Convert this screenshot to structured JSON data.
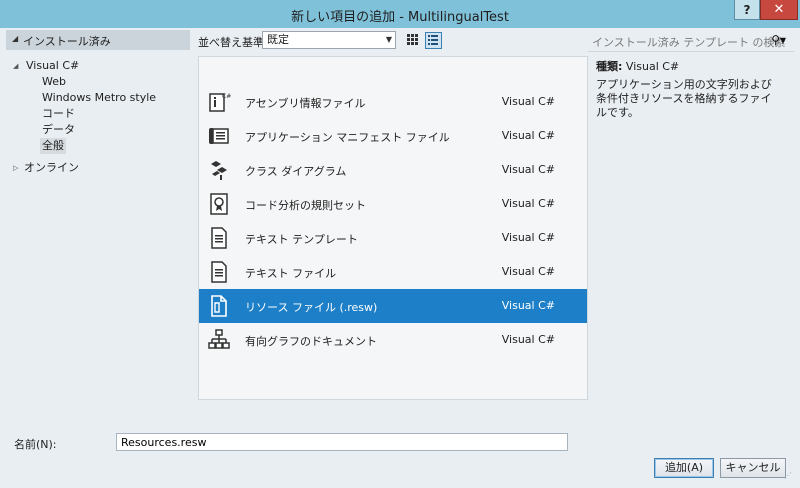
{
  "window": {
    "title": "新しい項目の追加 - MultilingualTest",
    "help_label": "?",
    "close_label": "✕"
  },
  "left_panel": {
    "header": "インストール済み",
    "tree": {
      "visual_csharp": "Visual C#",
      "children": [
        "Web",
        "Windows Metro style",
        "コード",
        "データ",
        "全般"
      ],
      "online": "オンライン"
    }
  },
  "toolbar": {
    "sort_label": "並べ替え基準:",
    "sort_value": "既定"
  },
  "templates": [
    {
      "name": "アセンブリ情報ファイル",
      "lang": "Visual C#",
      "icon": "assembly-info-icon"
    },
    {
      "name": "アプリケーション マニフェスト ファイル",
      "lang": "Visual C#",
      "icon": "manifest-icon"
    },
    {
      "name": "クラス ダイアグラム",
      "lang": "Visual C#",
      "icon": "class-diagram-icon"
    },
    {
      "name": "コード分析の規則セット",
      "lang": "Visual C#",
      "icon": "ruleset-icon"
    },
    {
      "name": "テキスト テンプレート",
      "lang": "Visual C#",
      "icon": "text-template-icon"
    },
    {
      "name": "テキスト ファイル",
      "lang": "Visual C#",
      "icon": "text-file-icon"
    },
    {
      "name": "リソース ファイル (.resw)",
      "lang": "Visual C#",
      "icon": "resource-file-icon",
      "selected": true
    },
    {
      "name": "有向グラフのドキュメント",
      "lang": "Visual C#",
      "icon": "directed-graph-icon"
    }
  ],
  "right_panel": {
    "search_placeholder": "インストール済み テンプレート の検索",
    "type_label": "種類:",
    "type_value": "Visual C#",
    "description": "アプリケーション用の文字列および条件付きリソースを格納するファイルです。"
  },
  "bottom": {
    "name_label": "名前(N):",
    "name_value": "Resources.resw",
    "add_label": "追加(A)",
    "cancel_label": "キャンセル"
  },
  "colors": {
    "title_bar": "#7fc1d9",
    "selection": "#1c7fc8",
    "close_button": "#c7483f"
  }
}
